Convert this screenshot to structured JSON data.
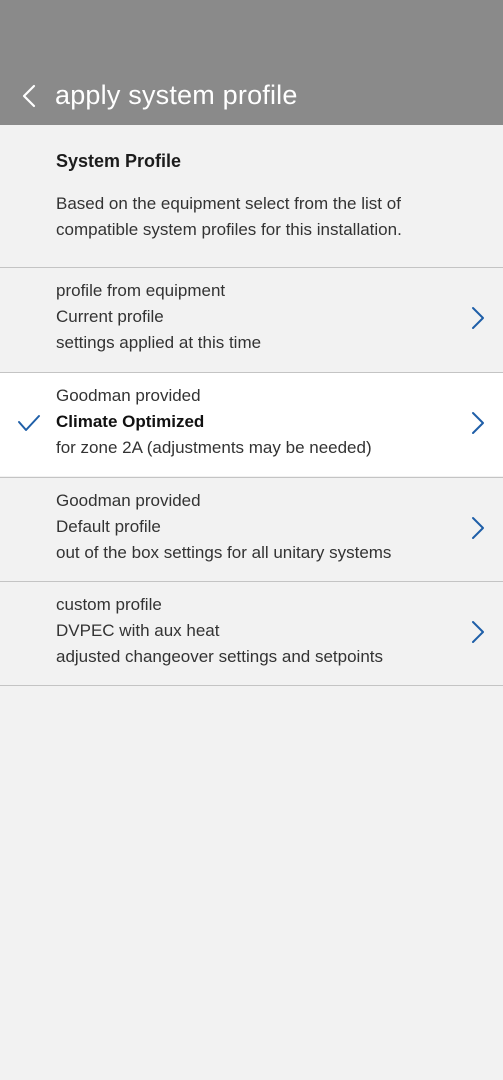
{
  "header": {
    "title": "apply system profile",
    "back_icon": "chevron-left-icon",
    "background": "#8a8a8a"
  },
  "intro": {
    "title": "System Profile",
    "description": "Based on the equipment select from the list of compatible system profiles for this installation."
  },
  "profiles": [
    {
      "source": "profile from equipment",
      "name": "Current profile",
      "description": "settings applied at this time",
      "selected": false
    },
    {
      "source": "Goodman provided",
      "name": "Climate Optimized",
      "description": "for zone 2A (adjustments may be needed)",
      "selected": true
    },
    {
      "source": "Goodman provided",
      "name": "Default profile",
      "description": "out of the box settings for all unitary systems",
      "selected": false
    },
    {
      "source": "custom profile",
      "name": "DVPEC with aux heat",
      "description": "adjusted changeover settings and setpoints",
      "selected": false
    }
  ],
  "colors": {
    "accent": "#1f5fa8",
    "selected_row": "#ffffff",
    "background": "#f2f2f2"
  }
}
